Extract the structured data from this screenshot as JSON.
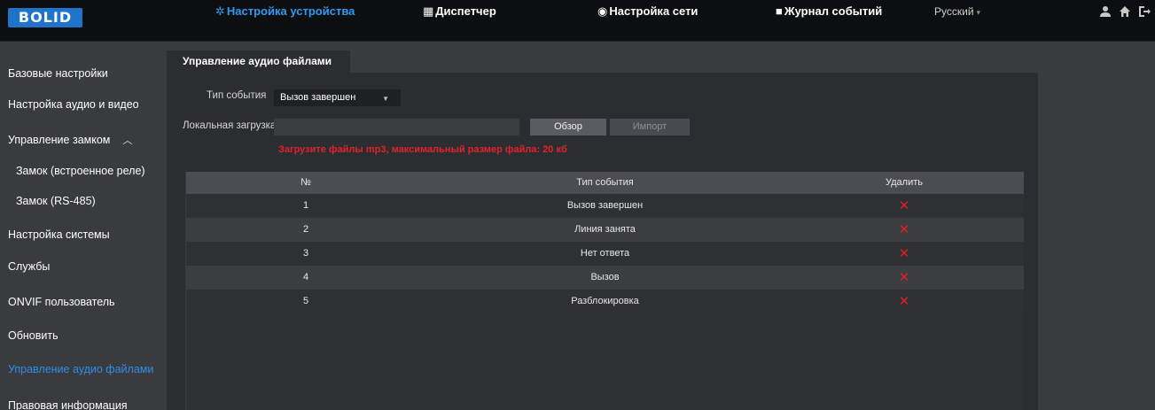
{
  "header": {
    "logo_text": "BOLID",
    "nav": [
      {
        "icon": "gear-icon",
        "glyph": "✲",
        "label": "Настройка устройства",
        "active": true
      },
      {
        "icon": "dispatcher-icon",
        "glyph": "▦",
        "label": "Диспетчер",
        "active": false
      },
      {
        "icon": "globe-icon",
        "glyph": "◉",
        "label": "Настройка сети",
        "active": false
      },
      {
        "icon": "log-icon",
        "glyph": "■",
        "label": "Журнал событий",
        "active": false
      }
    ],
    "language": "Русский",
    "icons": [
      "user-icon",
      "home-icon",
      "logout-icon"
    ]
  },
  "sidebar": {
    "items": [
      {
        "label": "Базовые настройки",
        "active": false
      },
      {
        "label": "Настройка аудио и видео",
        "active": false
      },
      {
        "label": "Управление замком",
        "active": false,
        "expanded": true
      },
      {
        "label": "Замок (встроенное реле)",
        "active": false
      },
      {
        "label": "Замок (RS-485)",
        "active": false
      },
      {
        "label": "Настройка системы",
        "active": false
      },
      {
        "label": "Службы",
        "active": false
      },
      {
        "label": "ONVIF пользователь",
        "active": false
      },
      {
        "label": "Обновить",
        "active": false
      },
      {
        "label": "Управление аудио файлами",
        "active": true
      },
      {
        "label": "Правовая информация",
        "active": false
      }
    ]
  },
  "main": {
    "tab_label": "Управление аудио файлами",
    "event_type_label": "Тип события",
    "event_type_value": "Вызов завершен",
    "local_upload_label": "Локальная загрузка",
    "browse_label": "Обзор",
    "import_label": "Импорт",
    "hint": "Загрузите файлы mp3, максимальный размер файла: 20 кб",
    "table": {
      "headers": [
        "№",
        "Тип события",
        "Удалить"
      ],
      "rows": [
        {
          "no": "1",
          "event": "Вызов завершен"
        },
        {
          "no": "2",
          "event": "Линия занята"
        },
        {
          "no": "3",
          "event": "Нет ответа"
        },
        {
          "no": "4",
          "event": "Вызов"
        },
        {
          "no": "5",
          "event": "Разблокировка"
        }
      ],
      "delete_glyph": "✕"
    }
  },
  "colors": {
    "accent": "#2e9bf0",
    "danger": "#e31e26",
    "logo_bg": "#1f73c8"
  }
}
